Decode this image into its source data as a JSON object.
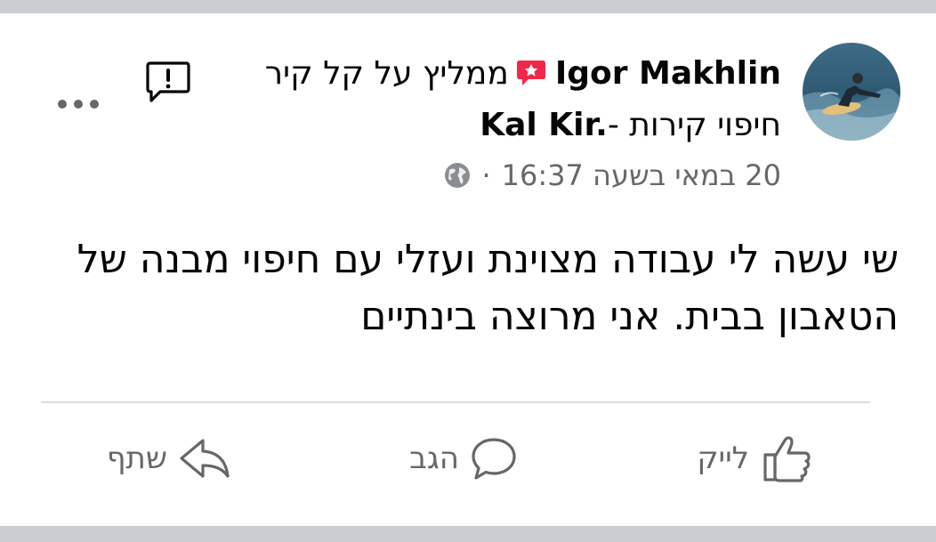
{
  "post": {
    "author_name": "Igor Makhlin",
    "recommend_text": "ממליץ על קל קיר",
    "subject_text": "חיפוי קירות - ",
    "page_name": "Kal Kir.",
    "timestamp": "20 במאי בשעה 16:37",
    "separator": "·",
    "body": "שי עשה לי עבודה מצוינת ועזלי עם חיפוי מבנה של הטאבון בבית. אני מרוצה בינתיים",
    "icons": {
      "recommend": "recommend-star-icon",
      "privacy": "globe-icon",
      "report": "report-icon",
      "more": "more-options-icon"
    }
  },
  "actions": {
    "like_label": "לייק",
    "comment_label": "הגב",
    "share_label": "שתף"
  },
  "colors": {
    "recommend_badge": "#f02849",
    "secondary_text": "#65676b",
    "primary_text": "#050505",
    "divider": "#dadde1",
    "page_background": "#c9ccd1"
  }
}
